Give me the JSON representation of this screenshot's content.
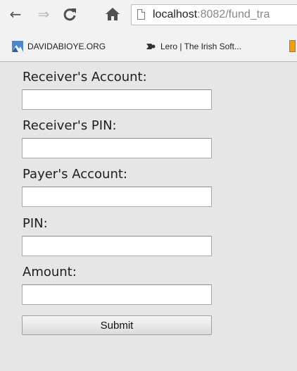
{
  "browser": {
    "nav": {
      "back_icon": "←",
      "forward_icon": "⇒",
      "reload_icon": "↻",
      "home_icon": "⌂"
    },
    "url_host": "localhost",
    "url_rest": ":8082/fund_tra",
    "bookmarks": [
      {
        "label": "DAVIDABIOYE.ORG",
        "icon": "mountain-favicon-icon"
      },
      {
        "label": "Lero | The Irish Soft...",
        "icon": "lero-favicon-icon"
      }
    ]
  },
  "form": {
    "fields": [
      {
        "label": "Receiver's Account:",
        "value": ""
      },
      {
        "label": "Receiver's PIN:",
        "value": ""
      },
      {
        "label": "Payer's Account:",
        "value": ""
      },
      {
        "label": "PIN:",
        "value": ""
      },
      {
        "label": "Amount:",
        "value": ""
      }
    ],
    "submit_label": "Submit"
  }
}
